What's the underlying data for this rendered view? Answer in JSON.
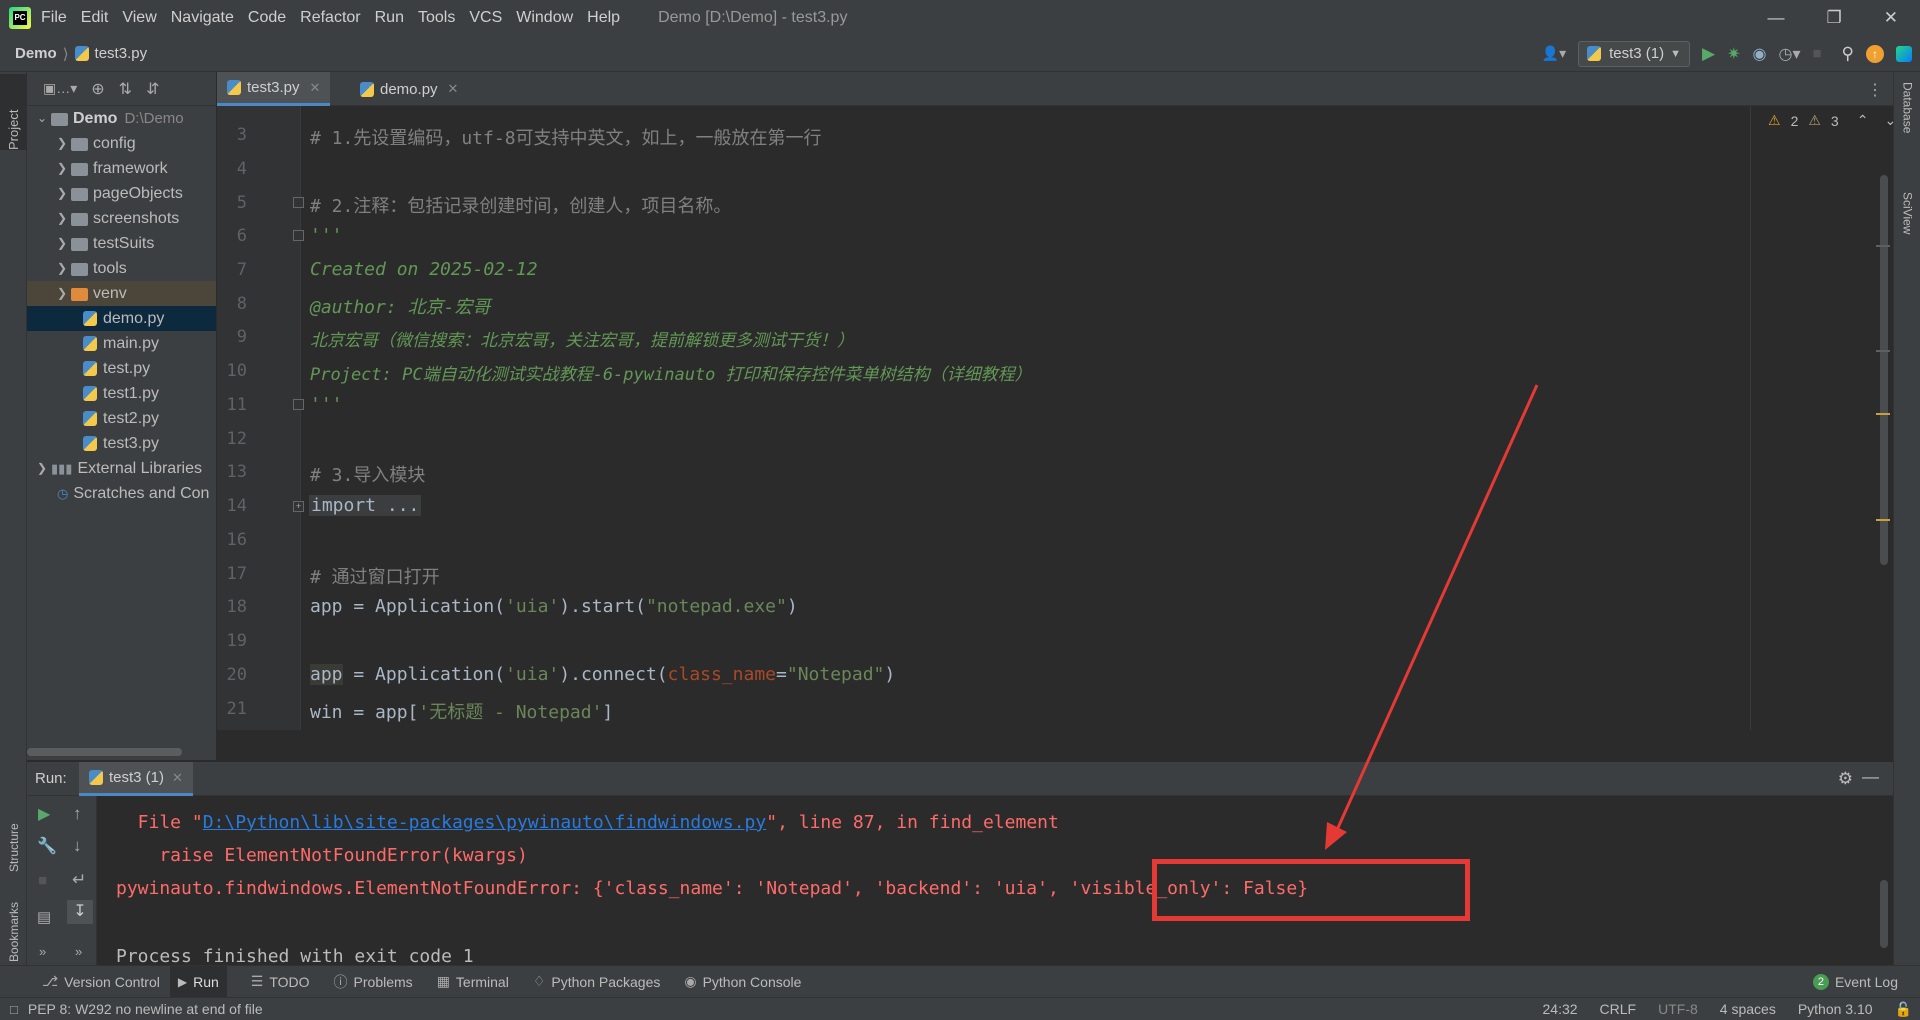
{
  "window": {
    "title": "Demo [D:\\Demo] - test3.py",
    "menu": [
      "File",
      "Edit",
      "View",
      "Navigate",
      "Code",
      "Refactor",
      "Run",
      "Tools",
      "VCS",
      "Window",
      "Help"
    ]
  },
  "nav": {
    "breadcrumb_project": "Demo",
    "breadcrumb_file": "test3.py",
    "run_config": "test3 (1)"
  },
  "left_strip": {
    "project": "Project",
    "structure": "Structure",
    "bookmarks": "Bookmarks"
  },
  "right_strip": {
    "database": "Database",
    "sciview": "SciView"
  },
  "project_tree": {
    "root_name": "Demo",
    "root_path": "D:\\Demo",
    "folders": [
      "config",
      "framework",
      "pageObjects",
      "screenshots",
      "testSuits",
      "tools",
      "venv"
    ],
    "files": [
      "demo.py",
      "main.py",
      "test.py",
      "test1.py",
      "test2.py",
      "test3.py"
    ],
    "external": "External Libraries",
    "scratches": "Scratches and Con"
  },
  "tabs": [
    {
      "label": "test3.py",
      "active": true
    },
    {
      "label": "demo.py",
      "active": false
    }
  ],
  "inspections": {
    "warnings": "2",
    "weak_warnings": "3"
  },
  "editor": {
    "line_numbers": [
      "3",
      "4",
      "5",
      "6",
      "7",
      "8",
      "9",
      "10",
      "11",
      "12",
      "13",
      "14",
      "16",
      "17",
      "18",
      "19",
      "20",
      "21"
    ],
    "line3": "# 1.先设置编码，utf-8可支持中英文，如上，一般放在第一行",
    "line5": "# 2.注释：包括记录创建时间，创建人，项目名称。",
    "line6": "'''",
    "line7": "Created on 2025-02-12",
    "line8": "@author: 北京-宏哥",
    "line9": "北京宏哥（微信搜索：北京宏哥，关注宏哥，提前解锁更多测试干货！）",
    "line10": "Project: PC端自动化测试实战教程-6-pywinauto 打印和保存控件菜单树结构（详细教程）",
    "line11": "'''",
    "line13": "# 3.导入模块",
    "line14": "import ...",
    "line17": "# 通过窗口打开",
    "line18_a": "app = Application(",
    "line18_b": "'uia'",
    "line18_c": ").start(",
    "line18_d": "\"notepad.exe\"",
    "line18_e": ")",
    "line20_a": "app",
    "line20_b": " = Application(",
    "line20_c": "'uia'",
    "line20_d": ").connect(",
    "line20_e": "class_name",
    "line20_f": "=",
    "line20_g": "\"Notepad\"",
    "line20_h": ")",
    "line21_a": "win = app[",
    "line21_b": "'无标题 - Notepad'",
    "line21_c": "]"
  },
  "run_panel": {
    "label": "Run:",
    "tab": "test3 (1)",
    "out1_a": "  File \"",
    "out1_link": "D:\\Python\\lib\\site-packages\\pywinauto\\findwindows.py",
    "out1_b": "\", line 87, in find_element",
    "out2": "    raise ElementNotFoundError(kwargs)",
    "out3": "pywinauto.findwindows.ElementNotFoundError: {'class_name': 'Notepad', 'backend': 'uia', 'visible_only': False}",
    "out4": "Process finished with exit code 1"
  },
  "bottom_tools": [
    "Version Control",
    "Run",
    "TODO",
    "Problems",
    "Terminal",
    "Python Packages",
    "Python Console"
  ],
  "event_log": {
    "count": "2",
    "label": "Event Log"
  },
  "status": {
    "message": "PEP 8: W292 no newline at end of file",
    "position": "24:32",
    "line_sep": "CRLF",
    "encoding": "UTF-8",
    "indent": "4 spaces",
    "interpreter": "Python 3.10"
  },
  "colors": {
    "annotation_red": "#e53935",
    "accent": "#4a88c7"
  }
}
